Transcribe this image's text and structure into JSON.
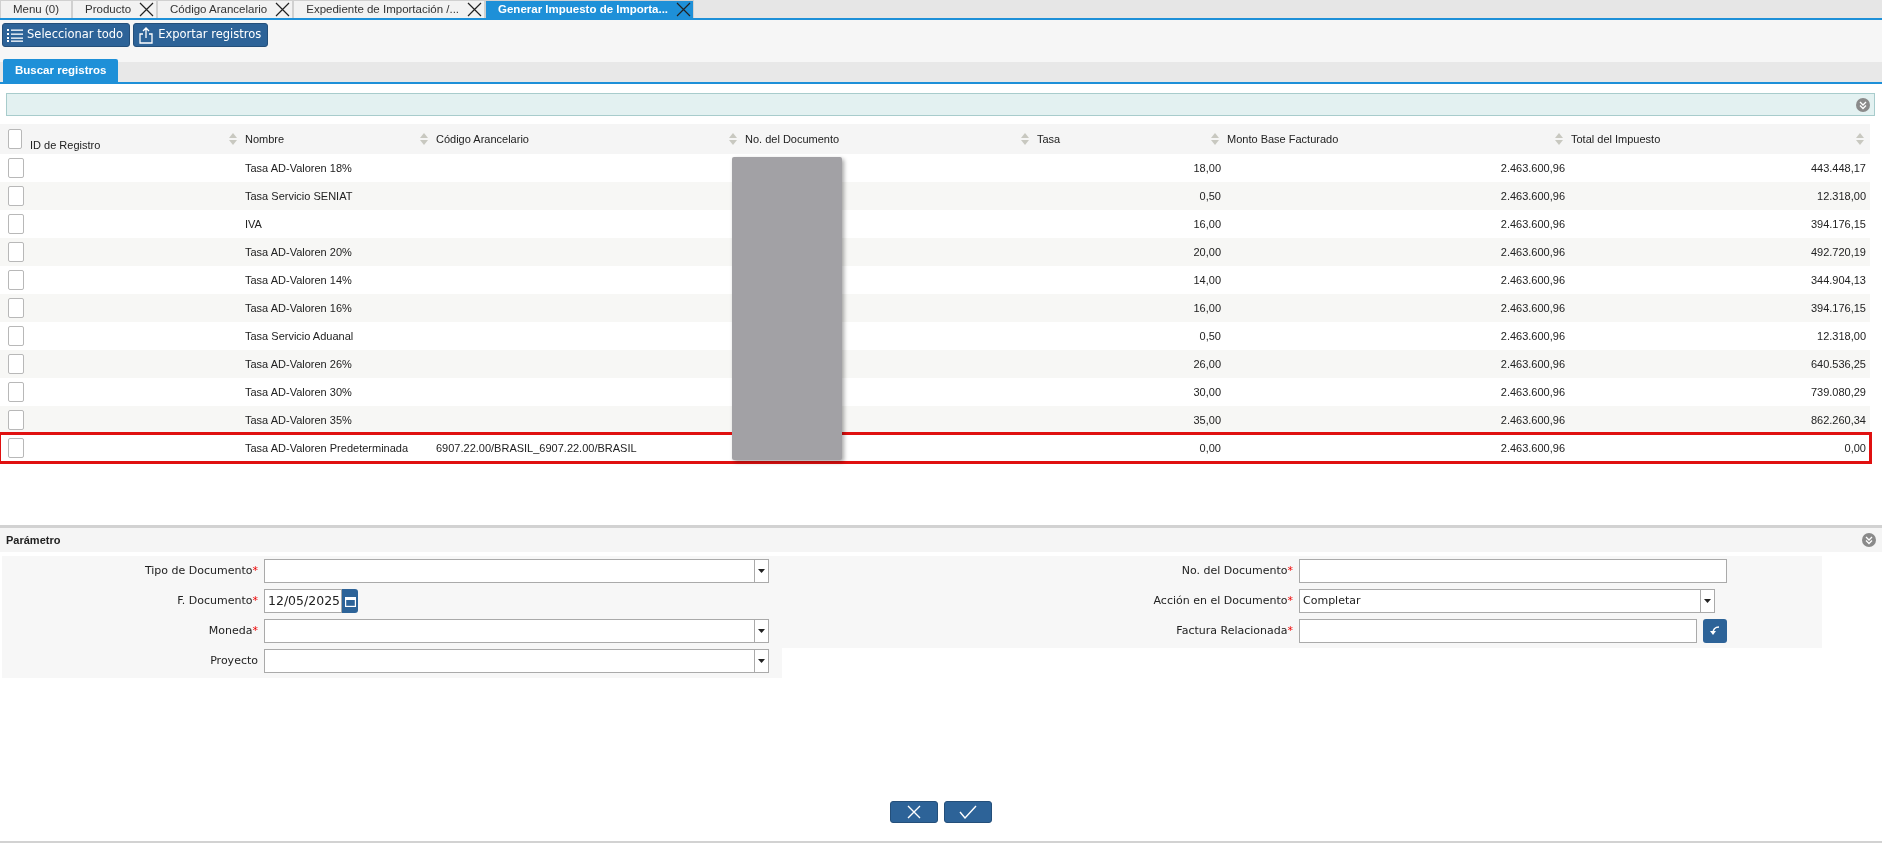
{
  "window_tabs": [
    {
      "label": "Menu (0)",
      "closable": false,
      "selected": false
    },
    {
      "label": "Producto",
      "closable": true,
      "selected": false
    },
    {
      "label": "Código Arancelario",
      "closable": true,
      "selected": false
    },
    {
      "label": "Expediente de Importación /...",
      "closable": true,
      "selected": false
    },
    {
      "label": "Generar Impuesto de Importa...",
      "closable": true,
      "selected": true
    }
  ],
  "toolbar": [
    {
      "label": "Seleccionar todo",
      "kind": "list"
    },
    {
      "label": "Exportar registros",
      "kind": "export"
    }
  ],
  "search_tab": {
    "label": "Buscar registros",
    "selected": true
  },
  "table": {
    "all_checked": false,
    "columns": [
      {
        "label": "ID de Registro"
      },
      {
        "label": "Nombre"
      },
      {
        "label": "Código Arancelario"
      },
      {
        "label": "No. del Documento",
        "redacted": true
      },
      {
        "label": "Tasa"
      },
      {
        "label": "Monto Base Facturado"
      },
      {
        "label": "Total del Impuesto"
      }
    ],
    "rows": [
      {
        "checked": false,
        "highlighted": false,
        "cells": [
          "",
          "Tasa AD-Valoren 18%",
          "",
          "",
          "18,00",
          "2.463.600,96",
          "443.448,17"
        ]
      },
      {
        "checked": false,
        "highlighted": false,
        "cells": [
          "",
          "Tasa Servicio SENIAT",
          "",
          "",
          "0,50",
          "2.463.600,96",
          "12.318,00"
        ]
      },
      {
        "checked": false,
        "highlighted": false,
        "cells": [
          "",
          "IVA",
          "",
          "",
          "16,00",
          "2.463.600,96",
          "394.176,15"
        ]
      },
      {
        "checked": false,
        "highlighted": false,
        "cells": [
          "",
          "Tasa AD-Valoren 20%",
          "",
          "",
          "20,00",
          "2.463.600,96",
          "492.720,19"
        ]
      },
      {
        "checked": false,
        "highlighted": false,
        "cells": [
          "",
          "Tasa AD-Valoren 14%",
          "",
          "",
          "14,00",
          "2.463.600,96",
          "344.904,13"
        ]
      },
      {
        "checked": false,
        "highlighted": false,
        "cells": [
          "",
          "Tasa AD-Valoren 16%",
          "",
          "",
          "16,00",
          "2.463.600,96",
          "394.176,15"
        ]
      },
      {
        "checked": false,
        "highlighted": false,
        "cells": [
          "",
          "Tasa Servicio Aduanal",
          "",
          "",
          "0,50",
          "2.463.600,96",
          "12.318,00"
        ]
      },
      {
        "checked": false,
        "highlighted": false,
        "cells": [
          "",
          "Tasa AD-Valoren 26%",
          "",
          "",
          "26,00",
          "2.463.600,96",
          "640.536,25"
        ]
      },
      {
        "checked": false,
        "highlighted": false,
        "cells": [
          "",
          "Tasa AD-Valoren 30%",
          "",
          "",
          "30,00",
          "2.463.600,96",
          "739.080,29"
        ]
      },
      {
        "checked": false,
        "highlighted": false,
        "cells": [
          "",
          "Tasa AD-Valoren 35%",
          "",
          "",
          "35,00",
          "2.463.600,96",
          "862.260,34"
        ]
      },
      {
        "checked": false,
        "highlighted": true,
        "cells": [
          "",
          "Tasa AD-Valoren Predeterminada",
          "6907.22.00/BRASIL_6907.22.00/BRASIL",
          "",
          "0,00",
          "2.463.600,96",
          "0,00"
        ]
      }
    ]
  },
  "parameters": {
    "title": "Parámetro",
    "left": [
      {
        "label": "Tipo de Documento",
        "required_mark": "*",
        "kind": "select"
      },
      {
        "label": "F. Documento",
        "required_mark": "*",
        "kind": "date",
        "value": "12/05/2025"
      },
      {
        "label": "Moneda",
        "required_mark": "*",
        "kind": "select"
      },
      {
        "label": "Proyecto",
        "kind": "select"
      }
    ],
    "right": [
      {
        "label": "No. del Documento",
        "required_mark": "*",
        "kind": "text"
      },
      {
        "label": "Acción en el Documento",
        "required_mark": "*",
        "kind": "select",
        "value": "Completar"
      },
      {
        "label": "Factura Relacionada",
        "required_mark": "*",
        "kind": "search"
      }
    ]
  },
  "footer_buttons": [
    {
      "kind": "cancel"
    },
    {
      "kind": "ok"
    }
  ]
}
